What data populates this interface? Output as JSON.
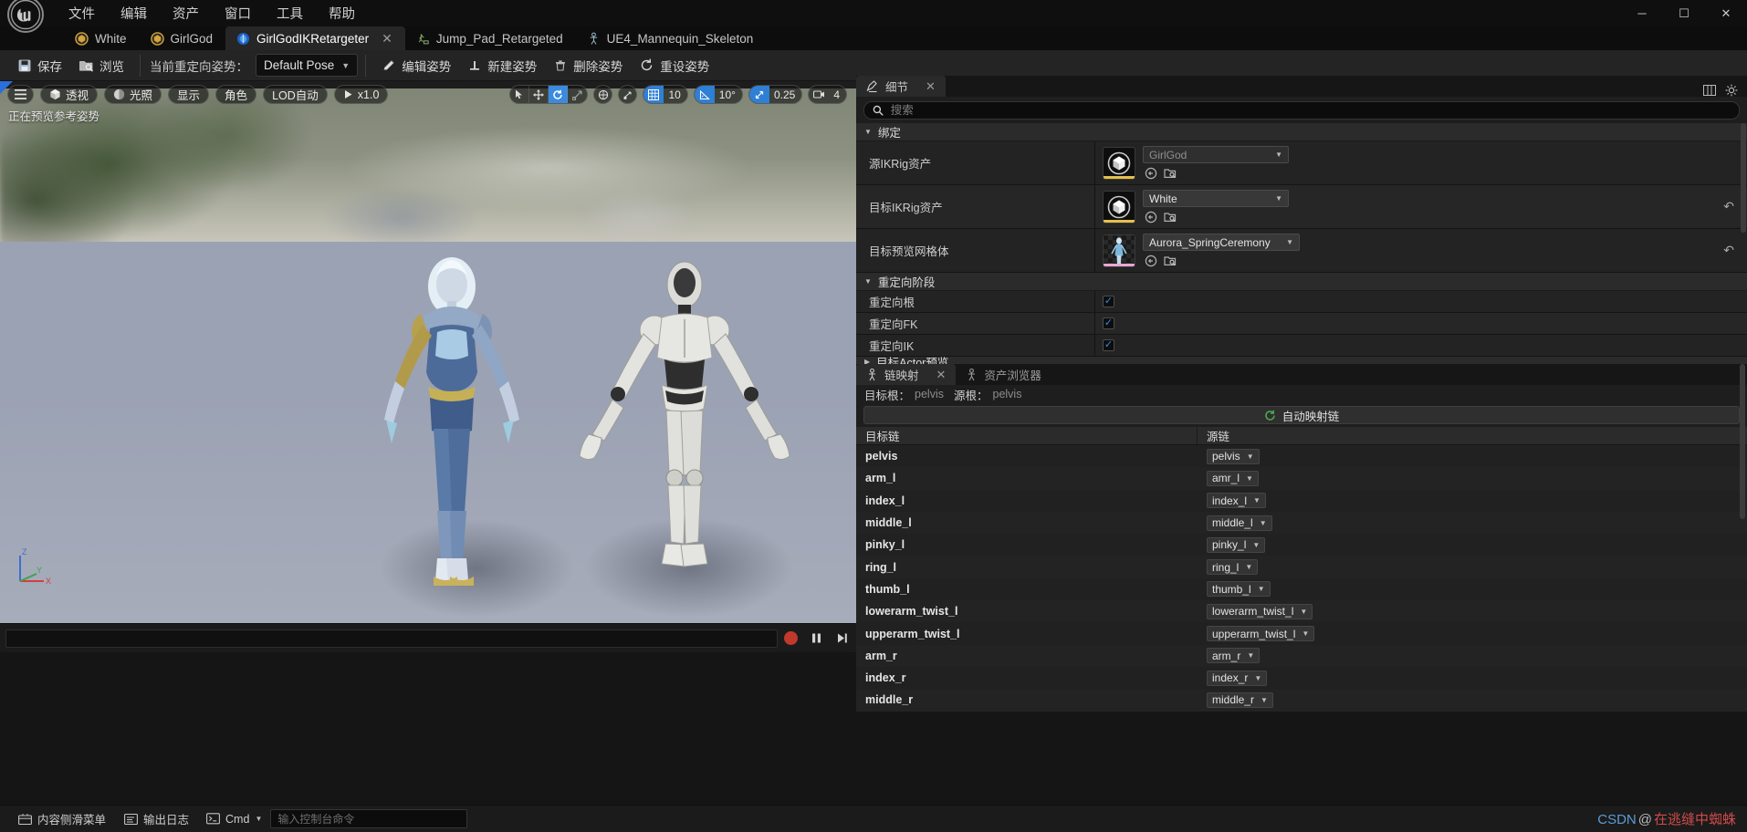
{
  "window": {
    "minimize_label": "─",
    "maximize_label": "☐",
    "close_label": "✕"
  },
  "menu": {
    "items": [
      {
        "label": "文件"
      },
      {
        "label": "编辑"
      },
      {
        "label": "资产"
      },
      {
        "label": "窗口"
      },
      {
        "label": "工具"
      },
      {
        "label": "帮助"
      }
    ]
  },
  "tabs": [
    {
      "label": "White",
      "icon": "asset-icon",
      "active": false,
      "closable": false
    },
    {
      "label": "GirlGod",
      "icon": "asset-icon",
      "active": false,
      "closable": false
    },
    {
      "label": "GirlGodIKRetargeter",
      "icon": "ik-retargeter-icon",
      "active": true,
      "closable": true,
      "close_label": "✕"
    },
    {
      "label": "Jump_Pad_Retargeted",
      "icon": "animation-icon",
      "active": false,
      "closable": false
    },
    {
      "label": "UE4_Mannequin_Skeleton",
      "icon": "skeleton-icon",
      "active": false,
      "closable": false
    }
  ],
  "toolbar": {
    "save_label": "保存",
    "browse_label": "浏览",
    "current_pose_label": "当前重定向姿势：",
    "pose_value": "Default Pose",
    "edit_pose_label": "编辑姿势",
    "new_pose_label": "新建姿势",
    "delete_pose_label": "删除姿势",
    "reset_pose_label": "重设姿势"
  },
  "viewport": {
    "menu_icon": "hamburger-icon",
    "perspective_label": "透视",
    "lighting_label": "光照",
    "show_label": "显示",
    "character_label": "角色",
    "lod_label": "LOD自动",
    "playrate_label": "x1.0",
    "status_text": "正在预览参考姿势",
    "grid_snap_value": "10",
    "angle_snap_value": "10°",
    "scale_snap_value": "0.25",
    "camera_speed_value": "4",
    "gizmo": {
      "x": "X",
      "y": "Y",
      "z": "Z"
    },
    "transform_modes": [
      "select-icon",
      "move-icon",
      "rotate-icon",
      "scale-icon"
    ],
    "active_transform_mode": 2
  },
  "details": {
    "tab_label": "细节",
    "tab_close": "✕",
    "search_placeholder": "搜索",
    "search_value": "",
    "sections": [
      {
        "title": "绑定",
        "expanded": true,
        "rows": [
          {
            "name": "源IKRig资产",
            "type": "asset",
            "value": "GirlGod",
            "dim": true,
            "thumb": "cube-icon",
            "underline": "#e5c14c",
            "has_revert": false
          },
          {
            "name": "目标IKRig资产",
            "type": "asset",
            "value": "White",
            "dim": false,
            "thumb": "cube-icon",
            "underline": "#e5c14c",
            "has_revert": true
          },
          {
            "name": "目标预览网格体",
            "type": "asset",
            "value": "Aurora_SpringCeremony",
            "dim": false,
            "thumb": "character-icon",
            "underline": "#e9a7d4",
            "has_revert": true
          }
        ]
      },
      {
        "title": "重定向阶段",
        "expanded": true,
        "rows": [
          {
            "name": "重定向根",
            "type": "checkbox",
            "checked": true
          },
          {
            "name": "重定向FK",
            "type": "checkbox",
            "checked": true
          },
          {
            "name": "重定向IK",
            "type": "checkbox",
            "checked": true
          }
        ]
      },
      {
        "title": "目标Actor预览",
        "expanded": false,
        "rows": []
      }
    ]
  },
  "chain_mapping": {
    "tabs": [
      {
        "label": "链映射",
        "icon": "chain-icon",
        "active": true,
        "close_label": "✕"
      },
      {
        "label": "资产浏览器",
        "icon": "asset-browser-icon",
        "active": false
      }
    ],
    "target_root_label": "目标根：",
    "target_root_value": "pelvis",
    "source_root_label": "源根：",
    "source_root_value": "pelvis",
    "auto_map_label": "自动映射链",
    "columns": {
      "target": "目标链",
      "source": "源链"
    },
    "rows": [
      {
        "target": "pelvis",
        "source": "pelvis"
      },
      {
        "target": "arm_l",
        "source": "amr_l"
      },
      {
        "target": "index_l",
        "source": "index_l"
      },
      {
        "target": "middle_l",
        "source": "middle_l"
      },
      {
        "target": "pinky_l",
        "source": "pinky_l"
      },
      {
        "target": "ring_l",
        "source": "ring_l"
      },
      {
        "target": "thumb_l",
        "source": "thumb_l"
      },
      {
        "target": "lowerarm_twist_l",
        "source": "lowerarm_twist_l"
      },
      {
        "target": "upperarm_twist_l",
        "source": "upperarm_twist_l"
      },
      {
        "target": "arm_r",
        "source": "arm_r"
      },
      {
        "target": "index_r",
        "source": "index_r"
      },
      {
        "target": "middle_r",
        "source": "middle_r"
      }
    ]
  },
  "statusbar": {
    "content_drawer_label": "内容侧滑菜单",
    "output_log_label": "输出日志",
    "cmd_label": "Cmd",
    "console_placeholder": "输入控制台命令",
    "console_value": "",
    "watermark_prefix": "CSDN",
    "watermark_at": "@",
    "watermark_user": "在逃缝中蜘蛛"
  },
  "colors": {
    "accent_blue": "#2f7fd4",
    "check_blue": "#2f8bef",
    "asset_yellow": "#e5c14c",
    "mesh_pink": "#e9a7d4",
    "record_red": "#c0392b"
  }
}
